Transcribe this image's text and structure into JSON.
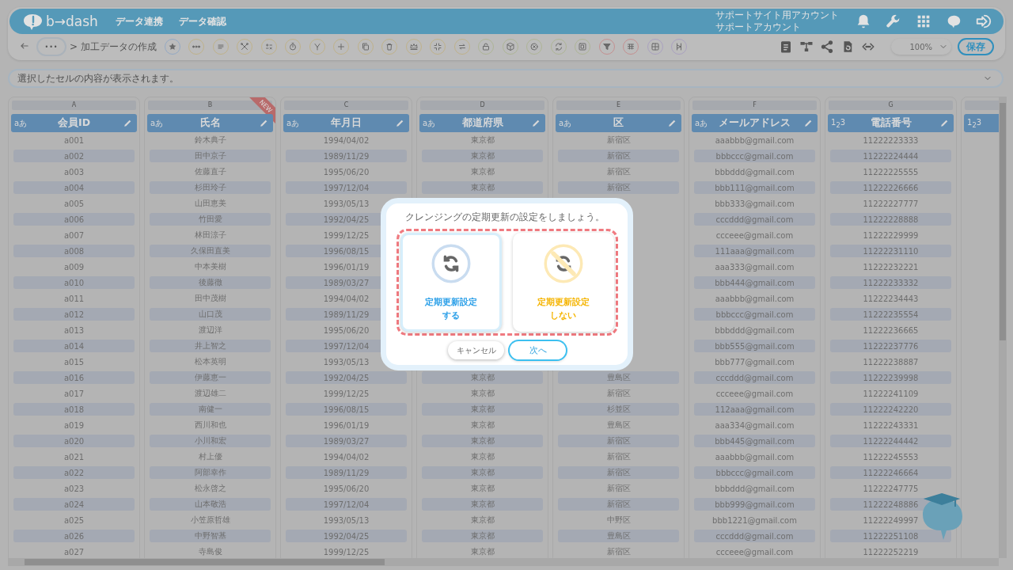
{
  "header": {
    "logo_text": "b→dash",
    "nav": [
      "データ連携",
      "データ確認"
    ],
    "account": [
      "サポートサイト用アカウント",
      "サポートアカウント"
    ],
    "icons": [
      {
        "kind": "bell"
      },
      {
        "kind": "wrench"
      },
      {
        "kind": "apps"
      },
      {
        "kind": "chat"
      },
      {
        "kind": "logout"
      }
    ]
  },
  "toolbar": {
    "more_label": "•••",
    "breadcrumb": "> 加工データの作成",
    "tools": [
      {
        "kind": "star",
        "color": "#93a9c4"
      },
      {
        "kind": "dots",
        "color": "#bfb28a"
      },
      {
        "kind": "lines",
        "color": "#bfb28a"
      },
      {
        "kind": "tools",
        "color": "#bfb28a"
      },
      {
        "kind": "calc",
        "color": "#bfb28a"
      },
      {
        "kind": "timer",
        "color": "#bfb28a"
      },
      {
        "kind": "fork",
        "color": "#bfb28a"
      },
      {
        "kind": "plus",
        "color": "#bfb28a"
      },
      {
        "kind": "copy",
        "color": "#bfb28a"
      },
      {
        "kind": "trash",
        "color": "#bfb28a"
      },
      {
        "kind": "crown",
        "color": "#bfb28a"
      },
      {
        "kind": "compress",
        "color": "#bfb28a"
      },
      {
        "kind": "swap",
        "color": "#bfb28a"
      },
      {
        "kind": "lock",
        "color": "#aeb596"
      },
      {
        "kind": "cube",
        "color": "#aeb596"
      },
      {
        "kind": "xcircle",
        "color": "#aeb596"
      },
      {
        "kind": "refresh",
        "color": "#aeb596"
      },
      {
        "kind": "bracket",
        "color": "#aeb596"
      },
      {
        "kind": "filter",
        "color": "#c49090"
      },
      {
        "kind": "org",
        "color": "#c49090"
      },
      {
        "kind": "grid",
        "color": "#aaa1c0"
      },
      {
        "kind": "split",
        "color": "#aaa1c0"
      }
    ],
    "right_icons": [
      {
        "kind": "clipboard"
      },
      {
        "kind": "hierarchy"
      },
      {
        "kind": "share"
      },
      {
        "kind": "docrefresh"
      },
      {
        "kind": "code"
      }
    ],
    "zoom": "100%",
    "save": "保存"
  },
  "cell_bar": {
    "placeholder": "選択したセルの内容が表示されます。"
  },
  "table": {
    "columns": [
      {
        "letter": "A",
        "type_badge": "aあ",
        "name": "会員ID",
        "editable": true
      },
      {
        "letter": "B",
        "type_badge": "aあ",
        "name": "氏名",
        "editable": true,
        "ribbon": "NEW"
      },
      {
        "letter": "C",
        "type_badge": "aあ",
        "name": "年月日",
        "editable": true
      },
      {
        "letter": "D",
        "type_badge": "aあ",
        "name": "都道府県",
        "editable": true
      },
      {
        "letter": "E",
        "type_badge": "aあ",
        "name": "区",
        "editable": true
      },
      {
        "letter": "F",
        "type_badge": "aあ",
        "name": "メールアドレス",
        "editable": true
      },
      {
        "letter": "G",
        "type_badge": "1$_{2}$3",
        "name": "電話番号",
        "editable": true
      },
      {
        "type_badge": "1$_{2}$3"
      }
    ],
    "rows": [
      {
        "cells": [
          "a001",
          "鈴木典子",
          "1994/04/02",
          "東京都",
          "新宿区",
          "aaabbb@gmail.com",
          "11222223333"
        ]
      },
      {
        "cells": [
          "a002",
          "田中京子",
          "1989/11/29",
          "東京都",
          "新宿区",
          "bbbccc@gmail.com",
          "11222224444"
        ]
      },
      {
        "cells": [
          "a003",
          "佐藤直子",
          "1995/06/20",
          "東京都",
          "新宿区",
          "bbbddd@gmail.com",
          "11222225555"
        ]
      },
      {
        "cells": [
          "a004",
          "杉田玲子",
          "1997/12/04",
          "東京都",
          "新宿区",
          "bbb111@gmail.com",
          "11222226666"
        ]
      },
      {
        "cells": [
          "a005",
          "山田恵美",
          "1993/05/13",
          null,
          null,
          "bbb333@gmail.com",
          "11222227777"
        ]
      },
      {
        "cells": [
          "a006",
          "竹田愛",
          "1992/04/25",
          null,
          null,
          "cccddd@gmail.com",
          "11222228888"
        ]
      },
      {
        "cells": [
          "a007",
          "林田涼子",
          "1999/12/25",
          null,
          null,
          "ccceee@gmail.com",
          "11222229999"
        ]
      },
      {
        "cells": [
          "a008",
          "久保田直美",
          "1996/08/15",
          null,
          null,
          "111aaa@gmail.com",
          "11222231110"
        ]
      },
      {
        "cells": [
          "a009",
          "中本美樹",
          "1996/01/19",
          null,
          null,
          "aaa333@gmail.com",
          "11222232221"
        ]
      },
      {
        "cells": [
          "a010",
          "後藤徹",
          "1989/03/27",
          null,
          null,
          "bbb444@gmail.com",
          "11222233332"
        ]
      },
      {
        "cells": [
          "a011",
          "田中茂樹",
          "1994/04/02",
          null,
          null,
          "aaabbb@gmail.com",
          "11222234443"
        ]
      },
      {
        "cells": [
          "a012",
          "山口茂",
          "1989/11/29",
          null,
          null,
          "bbbccc@gmail.com",
          "11222235554"
        ]
      },
      {
        "cells": [
          "a013",
          "渡辺洋",
          "1995/06/20",
          null,
          null,
          "bbbddd@gmail.com",
          "11222236665"
        ]
      },
      {
        "cells": [
          "a014",
          "井上智之",
          "1997/12/04",
          null,
          null,
          "bbb555@gmail.com",
          "11222237776"
        ]
      },
      {
        "cells": [
          "a015",
          "松本英明",
          "1993/05/13",
          null,
          null,
          "bbb777@gmail.com",
          "11222238887"
        ]
      },
      {
        "cells": [
          "a016",
          "伊藤恵一",
          "1992/04/25",
          "東京都",
          "豊島区",
          "cccddd@gmail.com",
          "11222239998"
        ]
      },
      {
        "cells": [
          "a017",
          "渡辺雄二",
          "1999/12/25",
          "東京都",
          "新宿区",
          "ccceee@gmail.com",
          "11222241109"
        ]
      },
      {
        "cells": [
          "a018",
          "南健一",
          "1996/08/15",
          "東京都",
          "杉並区",
          "112aaa@gmail.com",
          "11222242220"
        ]
      },
      {
        "cells": [
          "a019",
          "西川和也",
          "1996/01/19",
          "東京都",
          "豊島区",
          "aaa334@gmail.com",
          "11222243331"
        ]
      },
      {
        "cells": [
          "a020",
          "小川和宏",
          "1989/03/27",
          "東京都",
          "新宿区",
          "bbb445@gmail.com",
          "11222244442"
        ]
      },
      {
        "cells": [
          "a021",
          "村上優",
          "1994/04/02",
          "東京都",
          "新宿区",
          "aaabbb@gmail.com",
          "11222245553"
        ]
      },
      {
        "cells": [
          "a022",
          "阿部幸作",
          "1989/11/29",
          "東京都",
          "新宿区",
          "bbbccc@gmail.com",
          "11222246664"
        ]
      },
      {
        "cells": [
          "a023",
          "松永啓之",
          "1995/06/20",
          "東京都",
          "新宿区",
          "bbbddd@gmail.com",
          "11222247775"
        ]
      },
      {
        "cells": [
          "a024",
          "山本敬浩",
          "1997/12/04",
          "東京都",
          "新宿区",
          "bbb999@gmail.com",
          "11222248886"
        ]
      },
      {
        "cells": [
          "a025",
          "小笠原哲雄",
          "1993/05/13",
          "東京都",
          "中野区",
          "bbb1221@gmail.com",
          "11222249997"
        ]
      },
      {
        "cells": [
          "a026",
          "中野智基",
          "1992/04/25",
          "東京都",
          "豊島区",
          "cccddd@gmail.com",
          "11222251108"
        ]
      },
      {
        "cells": [
          "a027",
          "寺島俊",
          "1999/12/25",
          "東京都",
          "新宿区",
          "ccceee@gmail.com",
          "11222252219"
        ]
      }
    ]
  },
  "dialog": {
    "title": "クレンジングの定期更新の設定をしましょう。",
    "options": [
      {
        "kind": "enable",
        "label_lines": [
          "定期更新設定",
          "する"
        ],
        "color": "#2a9fe8",
        "selected": true
      },
      {
        "kind": "disable",
        "label_lines": [
          "定期更新設定",
          "しない"
        ],
        "color": "#f5b400",
        "selected": false
      }
    ],
    "buttons": [
      {
        "kind": "secondary",
        "label": "キャンセル"
      },
      {
        "kind": "primary",
        "label": "次へ"
      }
    ]
  }
}
